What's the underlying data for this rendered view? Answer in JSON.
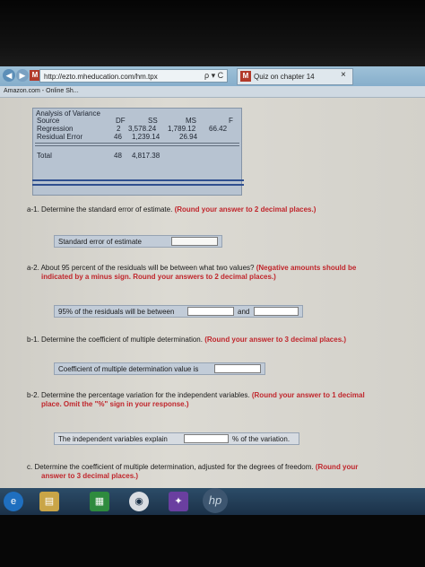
{
  "browser": {
    "address": "http://ezto.mheducation.com/hm.tpx",
    "addr_icons": "ρ ▾ C",
    "tab_title": "Quiz on chapter 14",
    "tab_close": "×",
    "favicon_letter": "M",
    "favorite": "Amazon.com - Online Sh..."
  },
  "anova": {
    "caption": "Analysis of Variance",
    "headers": [
      "Source",
      "DF",
      "SS",
      "MS",
      "F"
    ],
    "rows": [
      {
        "source": "Regression",
        "df": "2",
        "ss": "3,578.24",
        "ms": "1,789.12",
        "f": "66.42"
      },
      {
        "source": "Residual Error",
        "df": "46",
        "ss": "1,239.14",
        "ms": "26.94",
        "f": ""
      }
    ],
    "total": {
      "source": "Total",
      "df": "48",
      "ss": "4,817.38"
    }
  },
  "questions": {
    "a1": {
      "number": "a-1.",
      "text": "Determine the standard error of estimate.",
      "instruction": "(Round your answer to 2 decimal places.)",
      "label": "Standard error of estimate"
    },
    "a2": {
      "number": "a-2.",
      "text": "About 95 percent of the residuals will be between what two values?",
      "instruction_1": "(Negative amounts should be",
      "instruction_2": "indicated by a minus sign. Round your answers to 2 decimal places.)",
      "label": "95% of the residuals will be between",
      "and_label": "and"
    },
    "b1": {
      "number": "b-1.",
      "text": "Determine the coefficient of multiple determination.",
      "instruction": "(Round your answer to 3 decimal places.)",
      "label": "Coefficient of multiple determination value is"
    },
    "b2": {
      "number": "b-2.",
      "text": "Determine the percentage variation for the independent variables.",
      "instruction_1": "(Round your answer to 1 decimal",
      "instruction_2": "place. Omit the \"%\" sign in your response.)",
      "label": "The independent variables explain",
      "suffix": "% of the variation."
    },
    "c": {
      "number": "c.",
      "text": "Determine the coefficient of multiple determination, adjusted for the degrees of freedom.",
      "instruction_1": "(Round your",
      "instruction_2": "answer to 3 decimal places.)"
    }
  },
  "taskbar": {
    "hp_logo": "hp"
  },
  "colors": {
    "instruction_red": "#c0262c",
    "table_blue": "#b7c3d1",
    "accent_blue": "#2f4f8f"
  }
}
